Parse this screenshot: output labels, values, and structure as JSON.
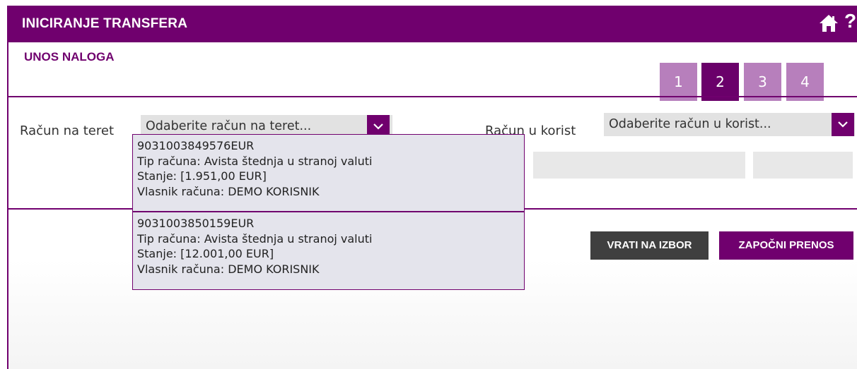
{
  "header": {
    "title": "INICIRANJE TRANSFERA",
    "help": "?"
  },
  "subheader": {
    "title": "UNOS NALOGA"
  },
  "steps": [
    {
      "label": "1",
      "active": false
    },
    {
      "label": "2",
      "active": true
    },
    {
      "label": "3",
      "active": false
    },
    {
      "label": "4",
      "active": false
    }
  ],
  "debit": {
    "label": "Račun na teret",
    "placeholder": "Odaberite račun na teret..."
  },
  "credit": {
    "label": "Račun u korist",
    "placeholder": "Odaberite račun u korist..."
  },
  "dropdown_options": [
    {
      "account": "9031003849576EUR",
      "type": "Tip računa: Avista štednja u stranoj valuti",
      "balance": "Stanje: [1.951,00 EUR]",
      "owner": "Vlasnik računa: DEMO KORISNIK"
    },
    {
      "account": "9031003850159EUR",
      "type": "Tip računa: Avista štednja u stranoj valuti",
      "balance": "Stanje: [12.001,00 EUR]",
      "owner": "Vlasnik računa: DEMO KORISNIK"
    }
  ],
  "buttons": {
    "back": "VRATI NA IZBOR",
    "start": "ZAPOČNI PRENOS"
  },
  "colors": {
    "brand": "#70006e",
    "step_inactive": "#b77fbc",
    "button_dark": "#3f3f3f"
  }
}
